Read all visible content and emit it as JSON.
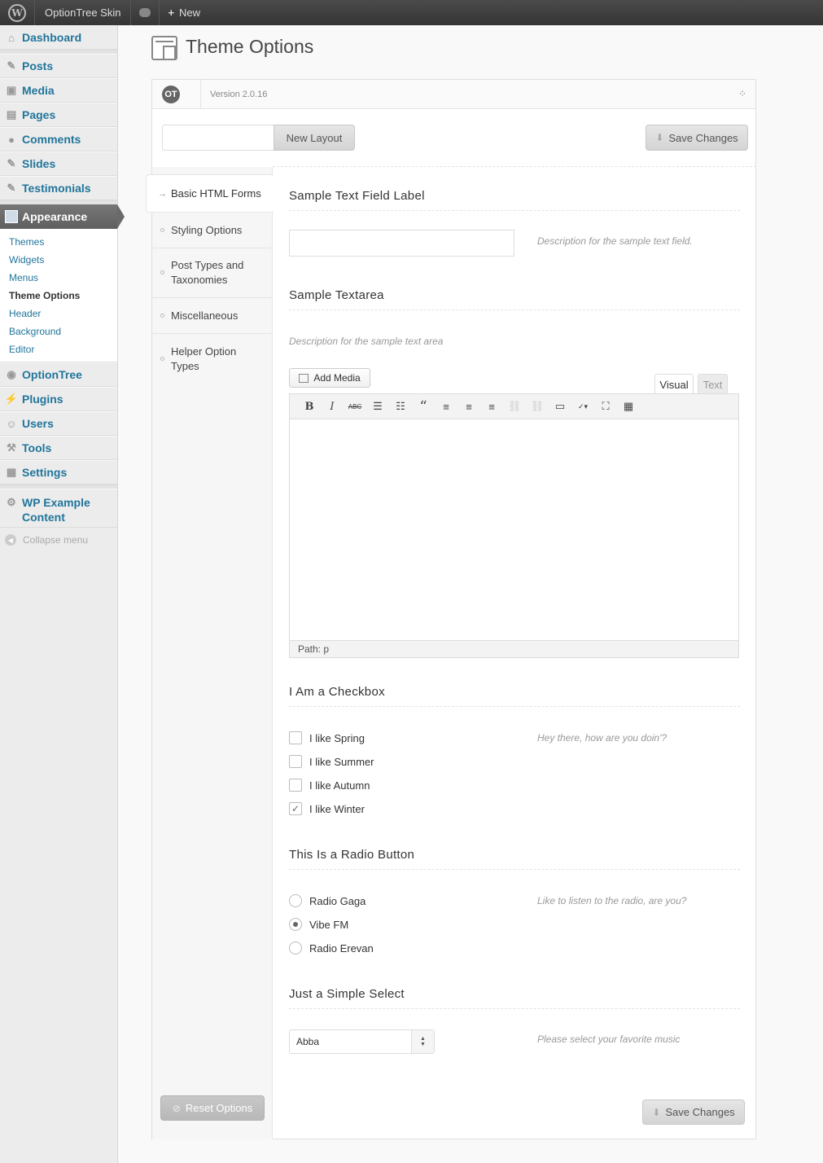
{
  "adminbar": {
    "site_name": "OptionTree Skin",
    "new_label": "New"
  },
  "sidebar": {
    "items": [
      {
        "label": "Dashboard",
        "icon": "dashboard-icon"
      },
      {
        "label": "Posts",
        "icon": "pin-icon"
      },
      {
        "label": "Media",
        "icon": "media-icon"
      },
      {
        "label": "Pages",
        "icon": "pages-icon"
      },
      {
        "label": "Comments",
        "icon": "comment-icon"
      },
      {
        "label": "Slides",
        "icon": "pin-icon"
      },
      {
        "label": "Testimonials",
        "icon": "pin-icon"
      }
    ],
    "current": {
      "label": "Appearance",
      "icon": "appearance-icon"
    },
    "submenu": [
      "Themes",
      "Widgets",
      "Menus",
      "Theme Options",
      "Header",
      "Background",
      "Editor"
    ],
    "items2": [
      {
        "label": "OptionTree",
        "icon": "optiontree-icon"
      },
      {
        "label": "Plugins",
        "icon": "plugin-icon"
      },
      {
        "label": "Users",
        "icon": "users-icon"
      },
      {
        "label": "Tools",
        "icon": "tools-icon"
      },
      {
        "label": "Settings",
        "icon": "settings-icon"
      }
    ],
    "example": {
      "label_line1": "WP Example",
      "label_line2": "Content",
      "icon": "gear-icon"
    },
    "collapse": "Collapse menu"
  },
  "page": {
    "title": "Theme Options"
  },
  "panel": {
    "version": "Version 2.0.16",
    "new_layout": "New Layout",
    "save_changes": "Save Changes",
    "reset": "Reset Options"
  },
  "tabs": {
    "active": "Basic HTML Forms",
    "items": [
      "Styling Options",
      "Post Types and Taxonomies",
      "Miscellaneous",
      "Helper Option Types"
    ]
  },
  "sections": {
    "text_field": {
      "label": "Sample Text Field Label",
      "value": "",
      "description": "Description for the sample text field."
    },
    "textarea": {
      "label": "Sample Textarea",
      "description": "Description for the sample text area",
      "add_media": "Add Media",
      "tab_visual": "Visual",
      "tab_text": "Text",
      "path": "Path: p"
    },
    "checkbox": {
      "label": "I Am a Checkbox",
      "description": "Hey there, how are you doin'?",
      "options": [
        {
          "label": "I like Spring",
          "checked": false
        },
        {
          "label": "I like Summer",
          "checked": false
        },
        {
          "label": "I like Autumn",
          "checked": false
        },
        {
          "label": "I like Winter",
          "checked": true
        }
      ]
    },
    "radio": {
      "label": "This Is a Radio Button",
      "description": "Like to listen to the radio, are you?",
      "options": [
        {
          "label": "Radio Gaga",
          "selected": false
        },
        {
          "label": "Vibe FM",
          "selected": true
        },
        {
          "label": "Radio Erevan",
          "selected": false
        }
      ]
    },
    "select": {
      "label": "Just a Simple Select",
      "value": "Abba",
      "description": "Please select your favorite music"
    }
  },
  "colors": {
    "link": "#21759b",
    "adminbar": "#464646",
    "sidebar_current": "#6a6a6a"
  }
}
